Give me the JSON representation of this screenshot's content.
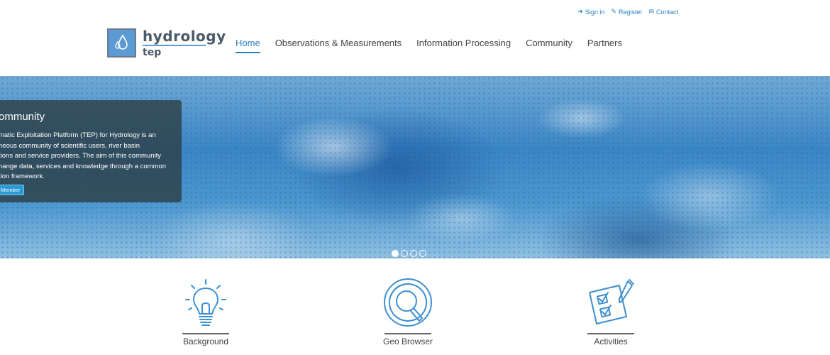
{
  "top_links": [
    {
      "label": "Sign in",
      "icon": "sign-in-icon",
      "glyph": "➜"
    },
    {
      "label": "Register",
      "icon": "edit-icon",
      "glyph": "✎"
    },
    {
      "label": "Contact",
      "icon": "envelope-icon",
      "glyph": "✉"
    }
  ],
  "logo": {
    "word": "hydrology",
    "sub": "tep"
  },
  "nav": [
    {
      "label": "Home",
      "active": true
    },
    {
      "label": "Observations & Measurements"
    },
    {
      "label": "Information Processing"
    },
    {
      "label": "Community"
    },
    {
      "label": "Partners"
    }
  ],
  "hero": {
    "title": "ommunity",
    "lines": [
      "matic Exploitation Platform (TEP) for Hydrology is an",
      "neous community of scientific users, river basin",
      "tions and service providers. The aim of this community",
      "hange data, services and knowledge through a common",
      "tion framework."
    ],
    "button": "Member",
    "slides": 4,
    "active_slide": 1
  },
  "features": [
    {
      "label": "Background",
      "icon": "lightbulb-icon"
    },
    {
      "label": "Geo Browser",
      "icon": "magnifier-icon"
    },
    {
      "label": "Activities",
      "icon": "checklist-icon"
    }
  ],
  "colors": {
    "accent": "#2a7fc1",
    "icon_blue": "#3d8fd0",
    "nav_text": "#444444"
  }
}
